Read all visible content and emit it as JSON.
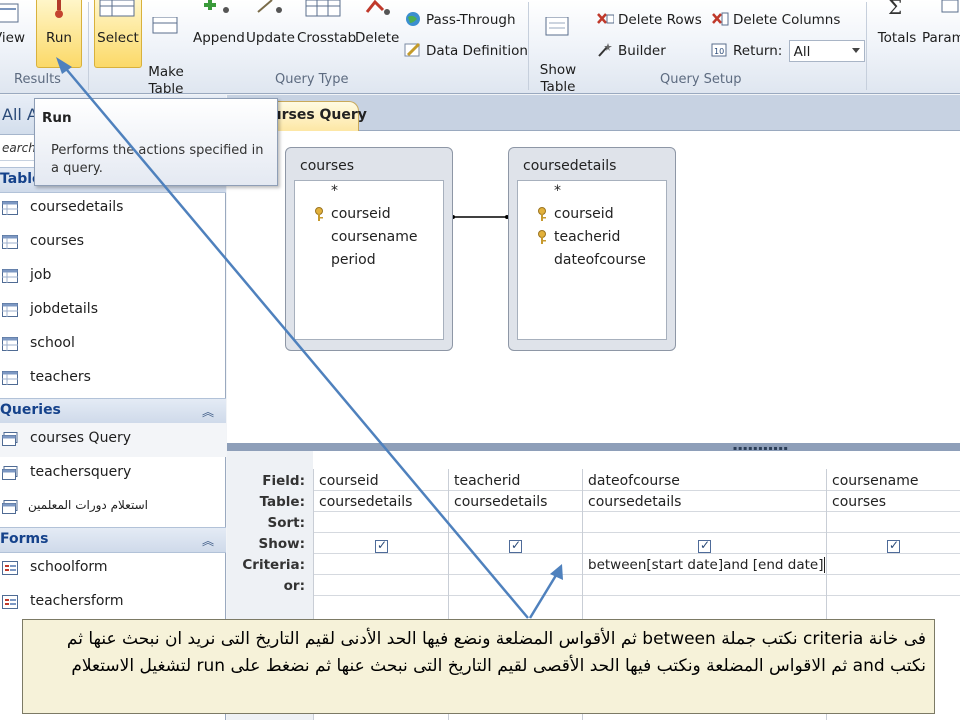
{
  "ribbon": {
    "view_label": "View",
    "run_label": "Run",
    "select_label": "Select",
    "make_table_label": "Make\nTable",
    "append_label": "Append",
    "update_label": "Update",
    "crosstab_label": "Crosstab",
    "delete_label": "Delete",
    "pass_through_label": "Pass-Through",
    "data_definition_label": "Data Definition",
    "show_table_label": "Show\nTable",
    "delete_rows_label": "Delete Rows",
    "builder_label": "Builder",
    "delete_columns_label": "Delete Columns",
    "return_label": "Return:",
    "return_value": "All",
    "totals_label": "Totals",
    "params_label": "Param",
    "groups": {
      "results": "Results",
      "query_type": "Query Type",
      "query_setup": "Query Setup"
    }
  },
  "tooltip": {
    "title": "Run",
    "body": "Performs the actions specified in a query."
  },
  "nav": {
    "header": "All Acc",
    "search_placeholder": "earch...",
    "groups": [
      {
        "title": "Tables",
        "items": [
          "coursedetails",
          "courses",
          "job",
          "jobdetails",
          "school",
          "teachers"
        ]
      },
      {
        "title": "Queries",
        "items": [
          "courses Query",
          "teachersquery",
          "استعلام دورات المعلمين"
        ]
      },
      {
        "title": "Forms",
        "items": [
          "schoolform",
          "teachersform"
        ]
      }
    ]
  },
  "document": {
    "tab_label": "ourses Query",
    "tables": [
      {
        "name": "courses",
        "fields": [
          "*",
          "courseid",
          "coursename",
          "period"
        ]
      },
      {
        "name": "coursedetails",
        "fields": [
          "*",
          "courseid",
          "teacherid",
          "dateofcourse"
        ]
      }
    ],
    "grid": {
      "row_labels": [
        "Field:",
        "Table:",
        "Sort:",
        "Show:",
        "Criteria:",
        "or:"
      ],
      "columns": [
        {
          "field": "courseid",
          "table": "coursedetails",
          "show": true,
          "criteria": ""
        },
        {
          "field": "teacherid",
          "table": "coursedetails",
          "show": true,
          "criteria": ""
        },
        {
          "field": "dateofcourse",
          "table": "coursedetails",
          "show": true,
          "criteria": "between[start date]and [end date]"
        },
        {
          "field": "coursename",
          "table": "courses",
          "show": true,
          "criteria": ""
        }
      ]
    }
  },
  "callout": {
    "text": "فى خانة criteria نكتب جملة between ثم الأقواس المضلعة ونضع فيها الحد الأدنى لقيم التاريخ التى نريد ان نبحث عنها ثم نكتب and ثم الاقواس المضلعة ونكتب فيها الحد الأقصى لقيم التاريخ التى نبحث عنها ثم نضغط على run لتشغيل الاستعلام"
  },
  "colors": {
    "ribbon_active": "#fbd968",
    "nav_group_text": "#15428b",
    "arrow": "#4f81bd",
    "callout_bg": "#f6f2d9"
  }
}
